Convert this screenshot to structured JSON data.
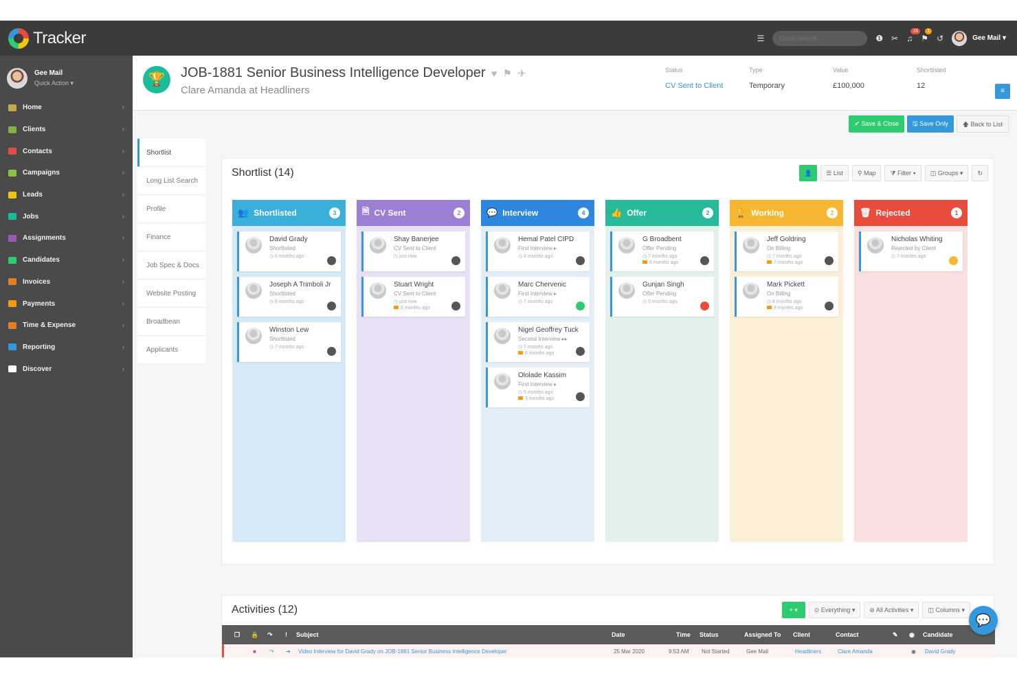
{
  "app": {
    "logo_text": "Tracker"
  },
  "user": {
    "name": "Gee Mail",
    "quick_action": "Quick Action ▾"
  },
  "nav": [
    {
      "label": "Home",
      "color": "#c7a94a"
    },
    {
      "label": "Clients",
      "color": "#7cb342"
    },
    {
      "label": "Contacts",
      "color": "#e74c3c"
    },
    {
      "label": "Campaigns",
      "color": "#8bc34a"
    },
    {
      "label": "Leads",
      "color": "#f1c40f"
    },
    {
      "label": "Jobs",
      "color": "#1abc9c"
    },
    {
      "label": "Assignments",
      "color": "#9b59b6"
    },
    {
      "label": "Candidates",
      "color": "#2ecc71"
    },
    {
      "label": "Invoices",
      "color": "#e67e22"
    },
    {
      "label": "Payments",
      "color": "#f39c12"
    },
    {
      "label": "Time & Expense",
      "color": "#e67e22"
    },
    {
      "label": "Reporting",
      "color": "#3498db"
    },
    {
      "label": "Discover",
      "color": "#ffffff"
    }
  ],
  "topbar": {
    "search_placeholder": "Quick Search...",
    "badge_notifications": "16",
    "badge_flags": "1",
    "user": "Gee Mail ▾"
  },
  "job": {
    "title": "JOB-1881 Senior Business Intelligence Developer",
    "subtitle": "Clare Amanda at Headliners",
    "status_label": "Status",
    "status_value": "CV Sent to Client",
    "type_label": "Type",
    "type_value": "Temporary",
    "value_label": "Value",
    "value_value": "£100,000",
    "shortlisted_label": "Shortlisted",
    "shortlisted_value": "12"
  },
  "actions": {
    "save_close": "✔ Save & Close",
    "save_only": "🖫 Save Only",
    "back": "🡅 Back to List"
  },
  "tabs": [
    "Shortlist",
    "Long List Search",
    "Profile",
    "Finance",
    "Job Spec & Docs",
    "Website Posting",
    "Broadbean",
    "Applicants"
  ],
  "shortlist": {
    "title": "Shortlist (14)",
    "tools": {
      "list": "☰ List",
      "map": "⚲ Map",
      "filter": "⧩ Filter ▾",
      "groups": "◫ Groups ▾",
      "refresh": "↻"
    },
    "columns": [
      {
        "name": "Shortlisted",
        "icon": "👥",
        "count": "3",
        "header_color": "#3bafda",
        "body_color": "#d5e9f6",
        "cards": [
          {
            "name": "David Grady",
            "status": "Shortlisted",
            "time": "◷ 6 months ago",
            "dot": "#555555"
          },
          {
            "name": "Joseph A Trimboli Jr",
            "status": "Shortlisted",
            "time": "◷ 6 months ago",
            "dot": "#555555"
          },
          {
            "name": "Winston Lew",
            "status": "Shortlisted",
            "time": "◷ 7 months ago",
            "dot": "#555555"
          }
        ]
      },
      {
        "name": "CV Sent",
        "icon": "🗎",
        "count": "2",
        "header_color": "#9b7fd4",
        "body_color": "#e8e0f5",
        "cards": [
          {
            "name": "Shay Banerjee",
            "status": "CV Sent to Client",
            "time": "◷ just now",
            "dot": "#555555"
          },
          {
            "name": "Stuart Wright",
            "status": "CV Sent to Client",
            "time": "◷ just now",
            "bar": "6 months ago",
            "dot": "#555555"
          }
        ]
      },
      {
        "name": "Interview",
        "icon": "💬",
        "count": "4",
        "header_color": "#2e86de",
        "body_color": "#e3eef8",
        "cards": [
          {
            "name": "Hemal Patel CIPD",
            "status": "First Interview ▸",
            "time": "◷ 6 months ago",
            "dot": "#555555"
          },
          {
            "name": "Marc Chervenic",
            "status": "First Interview ▸",
            "time": "◷ 7 months ago",
            "dot": "#2ecc71"
          },
          {
            "name": "Nigel Geoffrey Tuck",
            "status": "Second Interview ▸▸",
            "time": "◷ 7 months ago",
            "bar": "6 months ago",
            "dot": "#555555"
          },
          {
            "name": "Ololade Kassim",
            "status": "First Interview ▸",
            "time": "◷ 5 months ago",
            "bar": "3 months ago",
            "dot": "#555555"
          }
        ]
      },
      {
        "name": "Offer",
        "icon": "👍",
        "count": "2",
        "header_color": "#26b99a",
        "body_color": "#e3f1ec",
        "cards": [
          {
            "name": "G Broadbent",
            "status": "Offer Pending",
            "time": "◷ 7 months ago",
            "bar": "6 months ago",
            "dot": "#555555"
          },
          {
            "name": "Gunjan Singh",
            "status": "Offer Pending",
            "time": "◷ 5 months ago",
            "dot": "#e74c3c"
          }
        ]
      },
      {
        "name": "Working",
        "icon": "🏆",
        "count": "2",
        "header_color": "#f5b731",
        "body_color": "#fbefd7",
        "cards": [
          {
            "name": "Jeff Goldring",
            "status": "On Billing",
            "time": "◷ 7 months ago",
            "bar": "7 months ago",
            "dot": "#555555"
          },
          {
            "name": "Mark Pickett",
            "status": "On Billing",
            "time": "◷ 8 months ago",
            "bar": "8 months ago",
            "dot": "#555555"
          }
        ]
      },
      {
        "name": "Rejected",
        "icon": "🗑",
        "count": "1",
        "header_color": "#e74c3c",
        "body_color": "#f9e0de",
        "cards": [
          {
            "name": "Nicholas Whiting",
            "status": "Rejected by Client",
            "time": "◷ 7 months ago",
            "dot": "#f5b731"
          }
        ]
      }
    ]
  },
  "activities": {
    "title": "Activities (12)",
    "tools": {
      "add": "+ ▾",
      "everything": "⊙ Everything ▾",
      "all": "⊜ All Activities ▾",
      "columns": "◫ Columns ▾"
    },
    "headers": {
      "subject": "Subject",
      "date": "Date",
      "time": "Time",
      "status": "Status",
      "assigned": "Assigned To",
      "client": "Client",
      "contact": "Contact",
      "candidate": "Candidate"
    },
    "row": {
      "subject": "Video Interview for David Grady on JOB-1881 Senior Business Intelligence Developer",
      "date": "25 Mar 2020",
      "time": "9:53 AM",
      "status": "Not Started",
      "assigned": "Gee Mail",
      "client": "Headliners",
      "contact": "Clare Amanda",
      "candidate": "David Grady"
    }
  }
}
